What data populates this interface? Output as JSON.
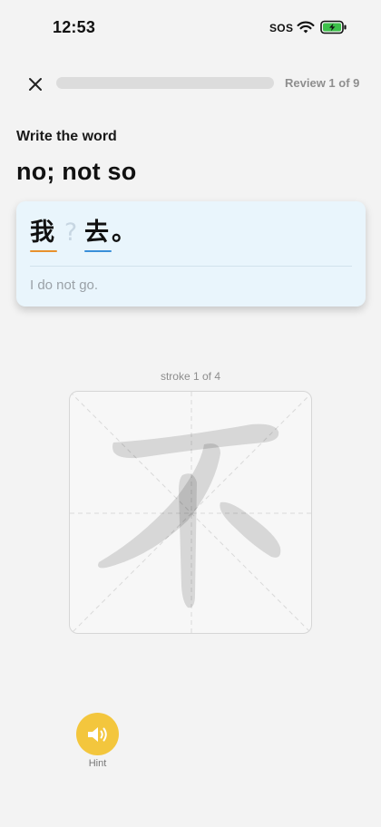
{
  "status_bar": {
    "time": "12:53",
    "sos": "SOS",
    "wifi_icon": "wifi-icon",
    "battery_icon": "battery-charging-icon",
    "battery_color": "#3cc04a"
  },
  "header": {
    "close_icon": "close-icon",
    "progress": 0.0,
    "review_label": "Review 1 of 9"
  },
  "prompt": {
    "instruction": "Write the word",
    "meaning": "no; not so"
  },
  "sentence": {
    "characters": [
      {
        "text": "我",
        "underline_color": "#e8912d"
      },
      {
        "text": "?",
        "underline_color": ""
      },
      {
        "text": "去",
        "underline_color": "#3a8fd9"
      },
      {
        "text": "。",
        "underline_color": ""
      }
    ],
    "translation": "I do not go."
  },
  "writing": {
    "stroke_counter": "stroke 1 of 4",
    "target_character": "不",
    "current_stroke": 1,
    "total_strokes": 4
  },
  "hint": {
    "icon": "speaker-icon",
    "label": "Hint",
    "color": "#f3c63d"
  }
}
